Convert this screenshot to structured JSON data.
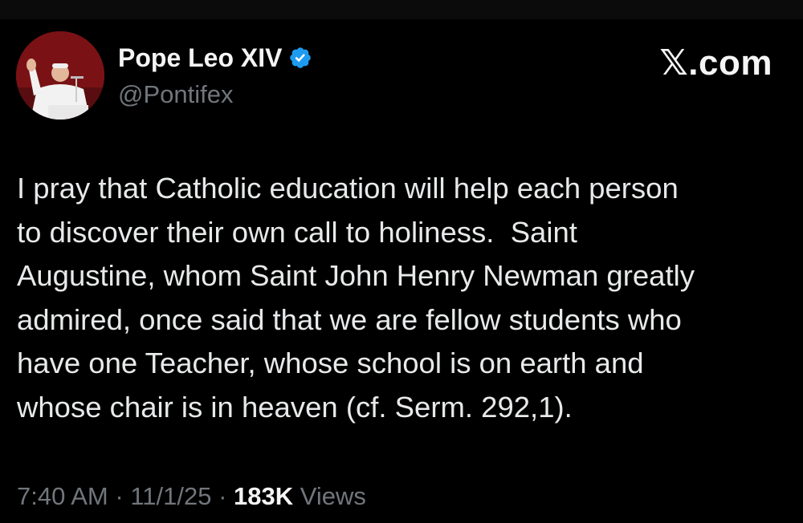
{
  "post": {
    "author": {
      "display_name": "Pope Leo XIV",
      "handle": "@Pontifex",
      "verified": true,
      "verified_icon": "verified-badge-icon",
      "verified_color": "#1d9bf0",
      "avatar_icon": "avatar-photo"
    },
    "brand_label": "𝕏.com",
    "text_lines": [
      "I pray that Catholic education will help each person",
      "to discover their own call to holiness.  Saint",
      "Augustine, whom Saint John Henry Newman greatly",
      "admired, once said that we are fellow students who",
      "have one Teacher, whose school is on earth and",
      "whose chair is in heaven (cf. Serm. 292,1)."
    ],
    "time": "7:40 AM",
    "separator": "·",
    "date": "11/1/25",
    "views_count": "183K",
    "views_label": "Views"
  },
  "colors": {
    "background": "#000000",
    "text": "#e7e9ea",
    "secondary": "#71767b",
    "avatar_backdrop": "#7a1215"
  }
}
